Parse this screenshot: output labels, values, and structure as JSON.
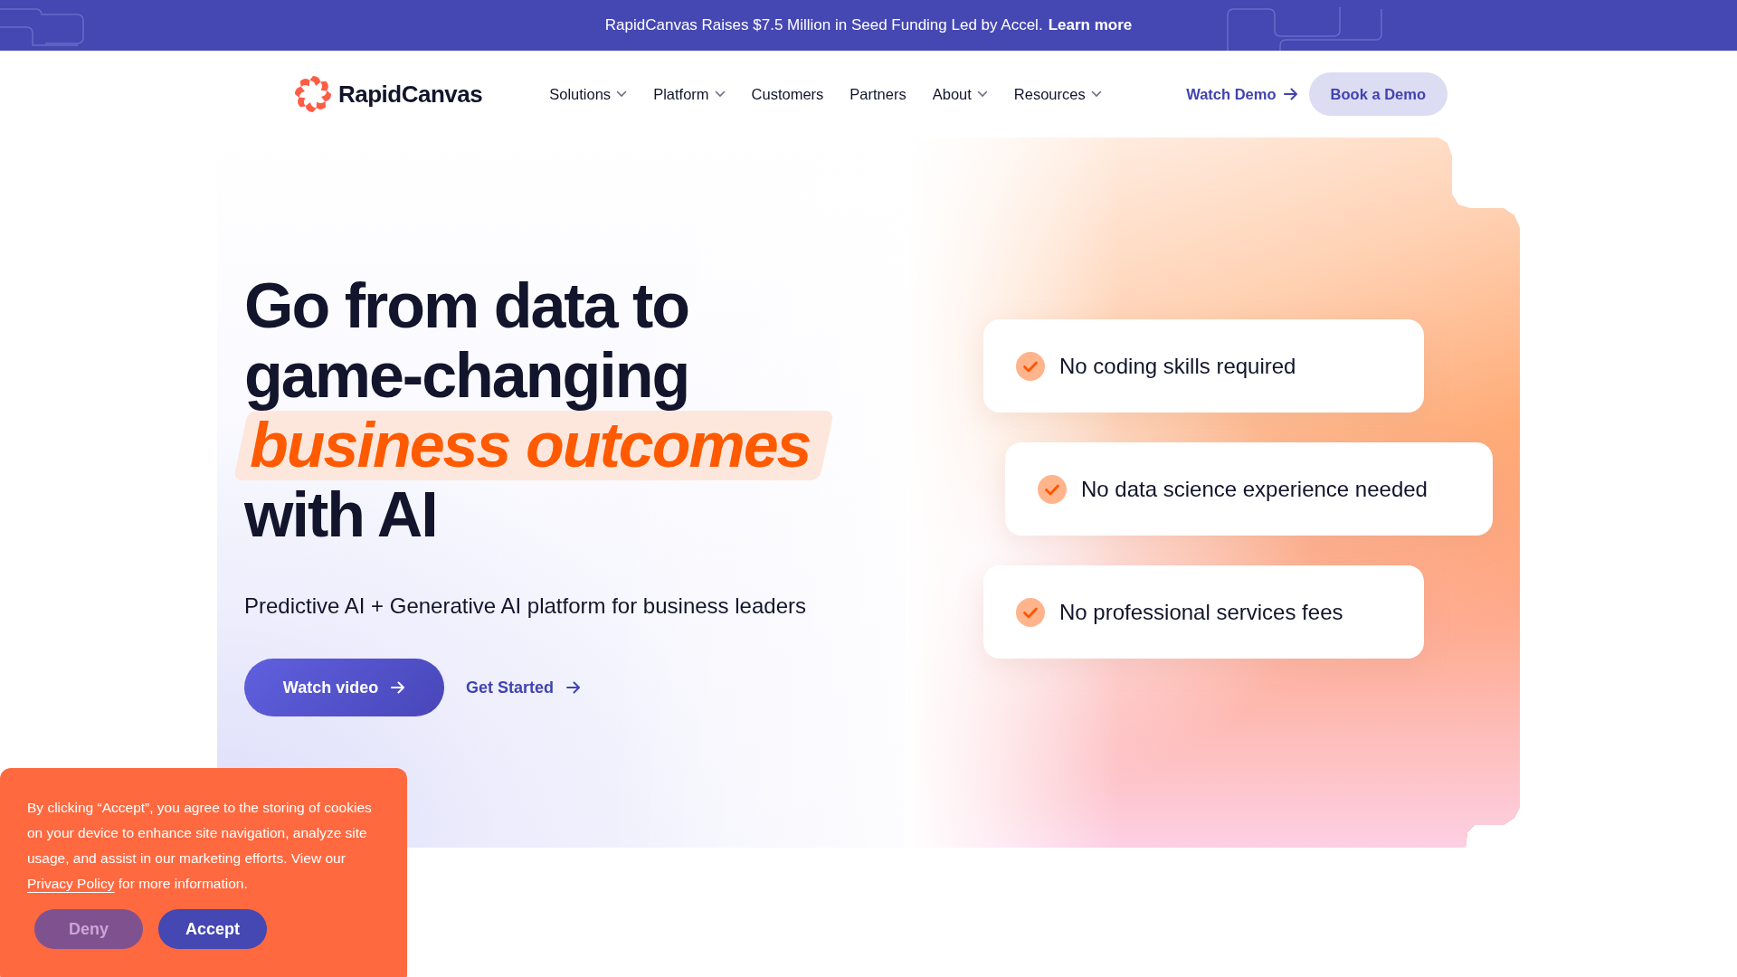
{
  "announcement": {
    "text": "RapidCanvas Raises $7.5 Million in Seed Funding Led by Accel.",
    "link": "Learn more"
  },
  "nav": {
    "logo": "RapidCanvas",
    "items": [
      {
        "label": "Solutions",
        "dropdown": true
      },
      {
        "label": "Platform",
        "dropdown": true
      },
      {
        "label": "Customers",
        "dropdown": false
      },
      {
        "label": "Partners",
        "dropdown": false
      },
      {
        "label": "About",
        "dropdown": true
      },
      {
        "label": "Resources",
        "dropdown": true
      }
    ],
    "watch_demo": "Watch Demo",
    "book_demo": "Book a Demo"
  },
  "hero": {
    "headline": [
      {
        "text": "Go from data to",
        "highlight": false
      },
      {
        "text": "game-changing",
        "highlight": false
      },
      {
        "text": "business outcomes",
        "highlight": true
      },
      {
        "text": "with AI",
        "highlight": false
      }
    ],
    "subtitle": "Predictive AI + Generative AI platform for business leaders",
    "primary_button": "Watch video",
    "secondary_link": "Get Started",
    "features": [
      {
        "text": "No coding skills required"
      },
      {
        "text": "No data science experience needed"
      },
      {
        "text": "No professional services fees"
      }
    ]
  },
  "cookie_banner": {
    "text_before": "By clicking “Accept”, you agree to the storing of cookies on your device to enhance site navigation, analyze site usage, and assist in our marketing efforts. View our",
    "link": "Privacy Policy",
    "text_after": "for more information.",
    "buttons": [
      {
        "label": "Deny",
        "kind": "secondary"
      },
      {
        "label": "Accept",
        "kind": "primary"
      }
    ]
  }
}
